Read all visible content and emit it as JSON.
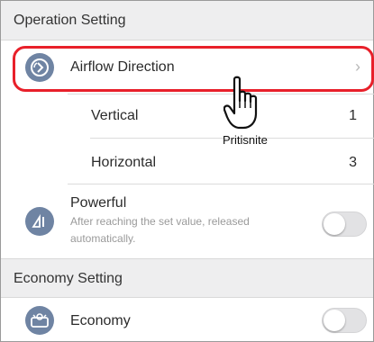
{
  "sections": {
    "operation": {
      "title": "Operation Setting"
    },
    "economy": {
      "title": "Economy Setting"
    }
  },
  "airflow": {
    "label": "Airflow Direction",
    "icon": "airflow-direction-icon",
    "chevron": "›"
  },
  "vertical": {
    "label": "Vertical",
    "value": "1"
  },
  "horizontal": {
    "label": "Horizontal",
    "value": "3"
  },
  "powerful": {
    "label": "Powerful",
    "description": "After reaching the set value, released automatically.",
    "icon": "powerful-icon",
    "enabled": false
  },
  "economy": {
    "label": "Economy",
    "icon": "economy-icon",
    "enabled": false
  },
  "annotation": {
    "caption": "Pritisnite",
    "highlight_color": "#e8202a",
    "pointer_icon": "hand-pointer-icon"
  },
  "colors": {
    "icon_bg": "#6f84a3",
    "header_bg": "#eeeeef",
    "toggle_off": "#e2e2e4"
  }
}
